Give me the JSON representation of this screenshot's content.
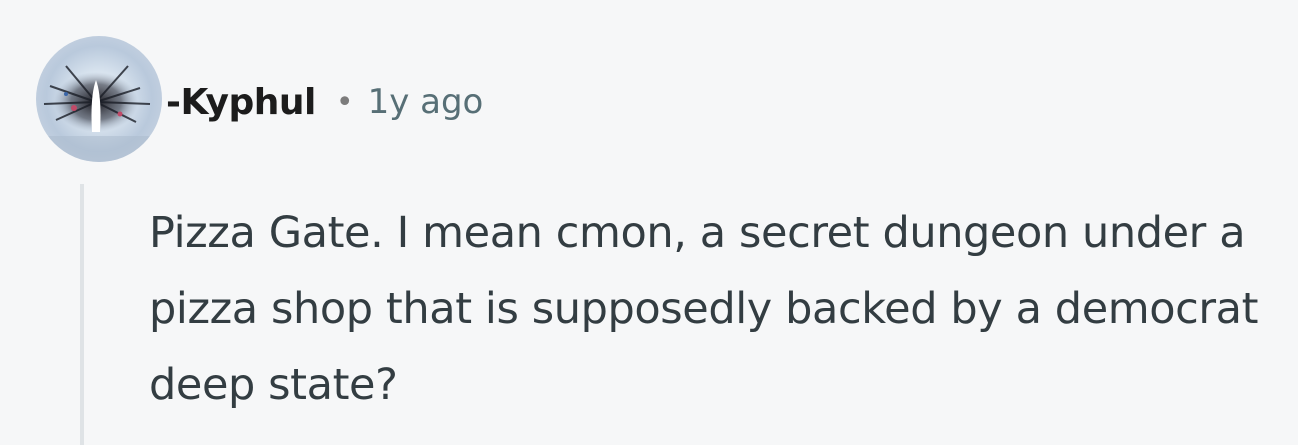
{
  "comment": {
    "username": "-Kyphul",
    "separator": "•",
    "timestamp": "1y ago",
    "body": "Pizza Gate. I mean cmon, a secret dungeon under a pizza shop that is supposedly backed by a democrat deep state?",
    "avatar_icon": "user-avatar-icon"
  },
  "colors": {
    "background": "#f6f7f8",
    "username": "#1c1c1c",
    "timestamp": "#576f76",
    "body_text": "#333d42",
    "thread_line": "#dfe3e6"
  }
}
